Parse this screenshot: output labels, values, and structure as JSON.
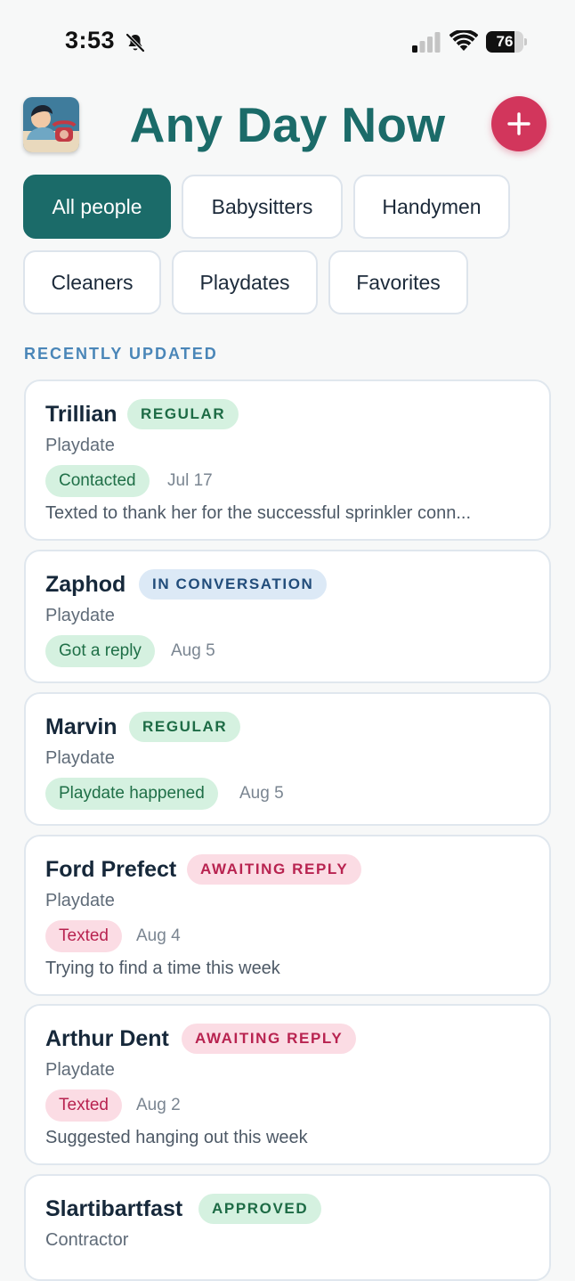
{
  "status_bar": {
    "time": "3:53",
    "battery_level": 76,
    "bell_icon": "bell-slash-icon",
    "signal_icon": "cellular-signal-icon",
    "wifi_icon": "wifi-icon"
  },
  "header": {
    "title": "Any Day Now",
    "add_icon": "plus-icon",
    "accent_color": "#1b6b69",
    "add_color": "#d2365c"
  },
  "filters": [
    "All people",
    "Babysitters",
    "Handymen",
    "Cleaners",
    "Playdates",
    "Favorites"
  ],
  "section_label": "RECENTLY UPDATED",
  "people": [
    {
      "name": "Trillian",
      "tag": "REGULAR",
      "type": "Playdate",
      "status": "Contacted",
      "date": "Jul 17",
      "note": "Texted to thank her for the successful sprinkler conn..."
    },
    {
      "name": "Zaphod",
      "tag": "IN CONVERSATION",
      "type": "Playdate",
      "status": "Got a reply",
      "date": "Aug 5",
      "note": ""
    },
    {
      "name": "Marvin",
      "tag": "REGULAR",
      "type": "Playdate",
      "status": "Playdate happened",
      "date": "Aug 5",
      "note": ""
    },
    {
      "name": "Ford Prefect",
      "tag": "AWAITING REPLY",
      "type": "Playdate",
      "status": "Texted",
      "date": "Aug 4",
      "note": "Trying to find a time this week"
    },
    {
      "name": "Arthur Dent",
      "tag": "AWAITING REPLY",
      "type": "Playdate",
      "status": "Texted",
      "date": "Aug 2",
      "note": "Suggested hanging out this week"
    },
    {
      "name": "Slartibartfast",
      "tag": "APPROVED",
      "type": "Contractor",
      "status": "",
      "date": "",
      "note": ""
    }
  ]
}
